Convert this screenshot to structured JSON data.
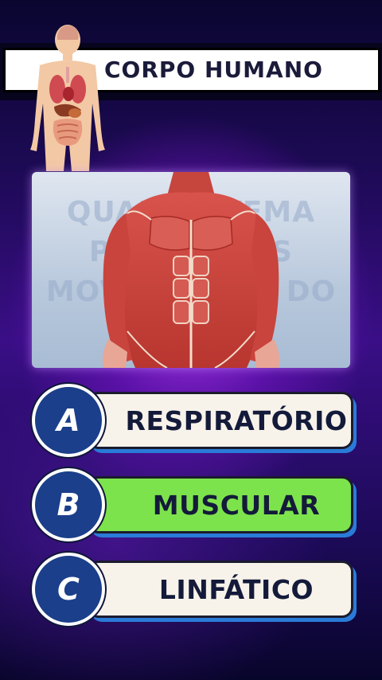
{
  "header": {
    "title": "CORPO HUMANO",
    "figure_icon": "human-anatomy-organs-icon"
  },
  "question_image": {
    "ghost_lines": [
      "QUAL SISTEMA",
      "PERMITE OS",
      "MOVIMENTOS DO"
    ],
    "subject": "muscular-system-torso-image"
  },
  "options": [
    {
      "letter": "A",
      "label": "RESPIRATÓRIO",
      "bg": "#f7f3ea",
      "selected": false
    },
    {
      "letter": "B",
      "label": "MUSCULAR",
      "bg": "#7de34c",
      "selected": true
    },
    {
      "letter": "C",
      "label": "LINFÁTICO",
      "bg": "#f7f3ea",
      "selected": false
    }
  ],
  "colors": {
    "accent_blue": "#2a7bd8",
    "circle_blue": "#1b3f8a",
    "correct_green": "#7de34c",
    "background_purple": "#3a0e86"
  }
}
